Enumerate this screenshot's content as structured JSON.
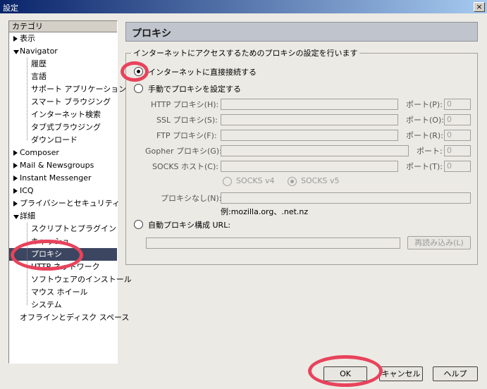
{
  "window": {
    "title": "設定",
    "close_glyph": "×"
  },
  "sidebar": {
    "header": "カテゴリ",
    "items": [
      {
        "label": "表示",
        "level": 0,
        "twisty": "closed"
      },
      {
        "label": "Navigator",
        "level": 0,
        "twisty": "open"
      },
      {
        "label": "履歴",
        "level": 1
      },
      {
        "label": "言語",
        "level": 1
      },
      {
        "label": "サポート アプリケーション",
        "level": 1
      },
      {
        "label": "スマート ブラウジング",
        "level": 1
      },
      {
        "label": "インターネット検索",
        "level": 1
      },
      {
        "label": "タブ式ブラウジング",
        "level": 1
      },
      {
        "label": "ダウンロード",
        "level": 1
      },
      {
        "label": "Composer",
        "level": 0,
        "twisty": "closed"
      },
      {
        "label": "Mail & Newsgroups",
        "level": 0,
        "twisty": "closed"
      },
      {
        "label": "Instant Messenger",
        "level": 0,
        "twisty": "closed"
      },
      {
        "label": "ICQ",
        "level": 0,
        "twisty": "closed"
      },
      {
        "label": "プライバシーとセキュリティ",
        "level": 0,
        "twisty": "closed"
      },
      {
        "label": "詳細",
        "level": 0,
        "twisty": "open"
      },
      {
        "label": "スクリプトとプラグイン",
        "level": 1
      },
      {
        "label": "キャッシュ",
        "level": 1
      },
      {
        "label": "プロキシ",
        "level": 1,
        "selected": true
      },
      {
        "label": "HTTP ネットワーク",
        "level": 1
      },
      {
        "label": "ソフトウェアのインストール",
        "level": 1
      },
      {
        "label": "マウス ホイール",
        "level": 1
      },
      {
        "label": "システム",
        "level": 1
      },
      {
        "label": "オフラインとディスク スペース",
        "level": 0
      }
    ]
  },
  "panel": {
    "title": "プロキシ",
    "group_label": "インターネットにアクセスするためのプロキシの設定を行います",
    "options": {
      "direct": "インターネットに直接接続する",
      "manual": "手動でプロキシを設定する",
      "auto": "自動プロキシ構成 URL:"
    },
    "selected_option": "direct",
    "proxies": [
      {
        "label": "HTTP プロキシ(H):",
        "port_label": "ポート(P):",
        "port": "0"
      },
      {
        "label": "SSL プロキシ(S):",
        "port_label": "ポート(O):",
        "port": "0"
      },
      {
        "label": "FTP プロキシ(F):",
        "port_label": "ポート(R):",
        "port": "0"
      },
      {
        "label": "Gopher プロキシ(G):",
        "port_label": "ポート:",
        "port": "0"
      },
      {
        "label": "SOCKS ホスト(C):",
        "port_label": "ポート(T):",
        "port": "0"
      }
    ],
    "socks_v4": "SOCKS v4",
    "socks_v5": "SOCKS v5",
    "socks_selected": "v5",
    "no_proxy_label": "プロキシなし(N):",
    "no_proxy_example": "例:mozilla.org、.net.nz",
    "reload_button": "再読み込み(L)"
  },
  "footer": {
    "ok": "OK",
    "cancel": "キャンセル",
    "help": "ヘルプ"
  },
  "colors": {
    "annotation_ring": "#e8435c",
    "selection": "#3c4660"
  }
}
